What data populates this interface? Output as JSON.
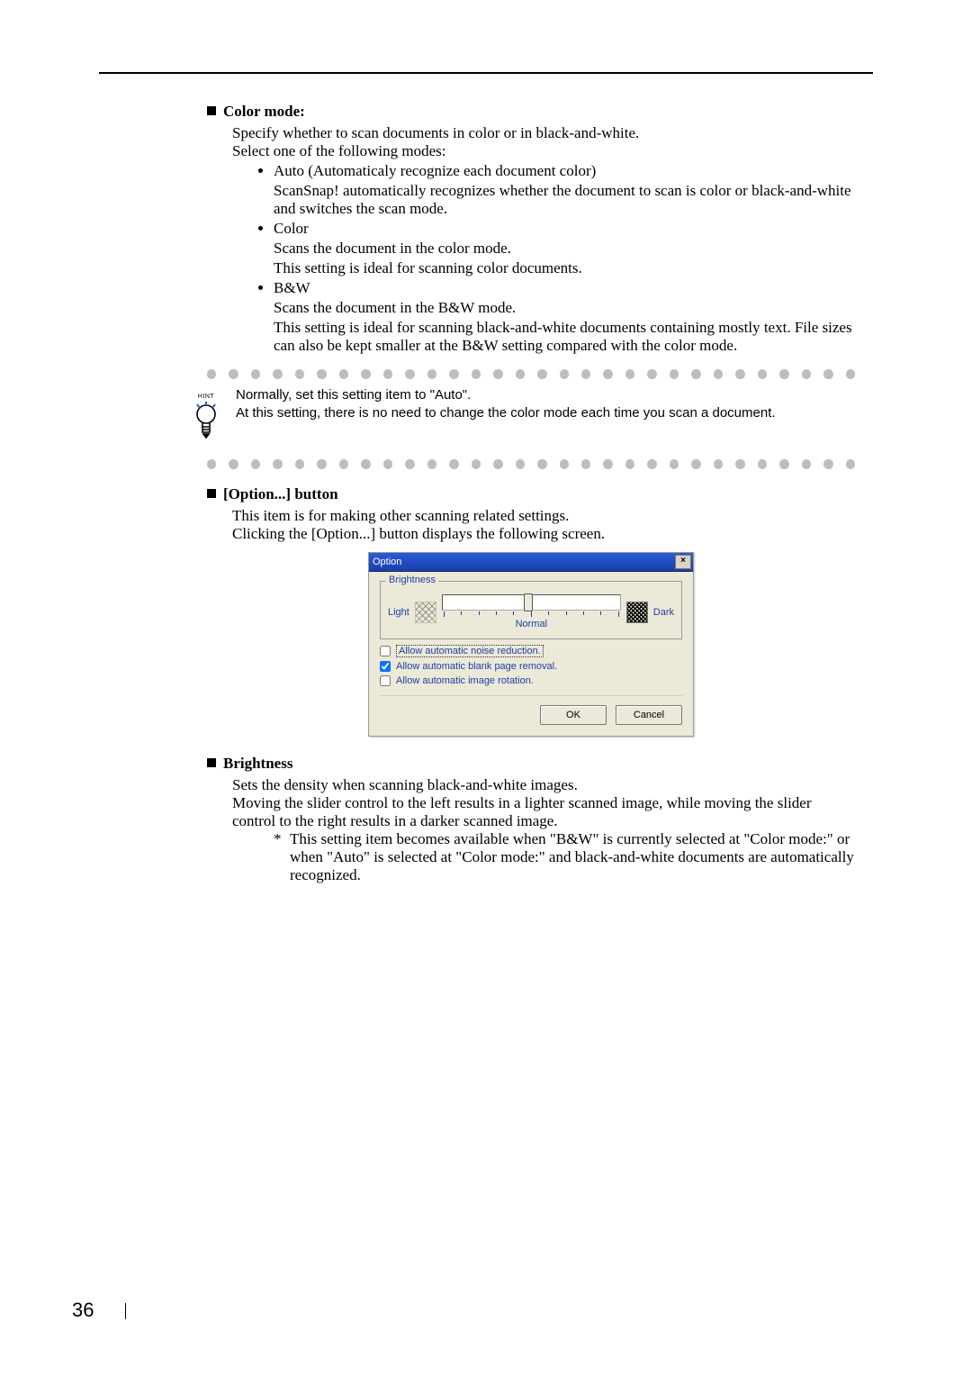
{
  "page_number": "36",
  "s1": {
    "heading": "Color mode:",
    "intro1": "Specify whether to scan documents in color or in black-and-white.",
    "intro2": "Select one of the following modes:",
    "opt1_title": "Auto (Automaticaly recognize each document color)",
    "opt1_desc": "ScanSnap! automatically recognizes whether the document to scan is color or black-and-white and switches the scan mode.",
    "opt2_title": "Color",
    "opt2_desc1": "Scans the document in the color mode.",
    "opt2_desc2": "This setting is ideal for scanning color documents.",
    "opt3_title": "B&W",
    "opt3_desc1": "Scans the document in the B&W mode.",
    "opt3_desc2": "This setting is ideal for scanning black-and-white documents containing mostly text.  File sizes can also be kept smaller at the B&W setting compared with the color mode."
  },
  "hint": {
    "label": "HINT",
    "line1": "Normally, set this setting item to \"Auto\".",
    "line2": "At this setting, there is no need to change the color mode each time you scan a document."
  },
  "s2": {
    "heading": "[Option...] button",
    "line1": "This item is for making other scanning related settings.",
    "line2": "Clicking the [Option...] button displays the following screen."
  },
  "dialog": {
    "title": "Option",
    "group_label": "Brightness",
    "light": "Light",
    "dark": "Dark",
    "normal": "Normal",
    "chk1": "Allow automatic noise reduction.",
    "chk2": "Allow automatic blank page removal.",
    "chk3": "Allow automatic image rotation.",
    "ok": "OK",
    "cancel": "Cancel"
  },
  "s3": {
    "heading": "Brightness",
    "line1": "Sets the density when scanning black-and-white images.",
    "line2": "Moving the slider control to the left results in a lighter scanned image, while moving the slider control to the right results in a darker scanned image.",
    "note_mark": "*",
    "note": "This setting item becomes available when \"B&W\" is currently selected at \"Color mode:\" or when \"Auto\" is selected at \"Color mode:\" and black-and-white documents are automatically recognized."
  }
}
